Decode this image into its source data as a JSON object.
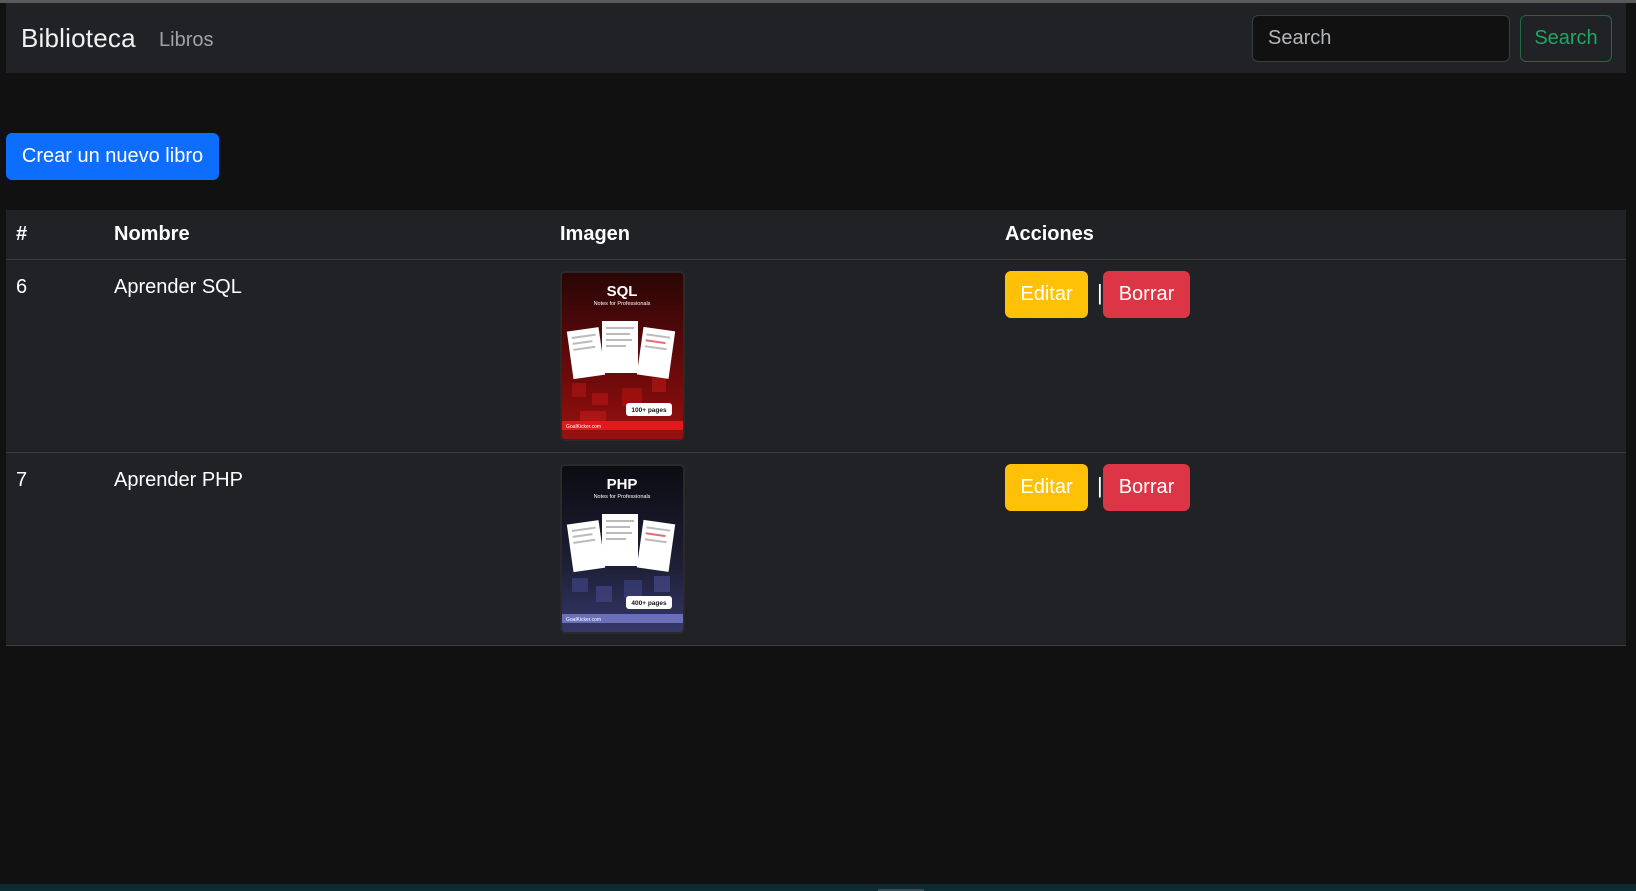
{
  "navbar": {
    "brand": "Biblioteca",
    "link": "Libros",
    "search_placeholder": "Search",
    "search_button": "Search"
  },
  "actions": {
    "create_label": "Crear un nuevo libro"
  },
  "table": {
    "headers": [
      "#",
      "Nombre",
      "Imagen",
      "Acciones"
    ],
    "rows": [
      {
        "id": "6",
        "name": "Aprender SQL",
        "cover_title": "SQL",
        "cover_subtitle": "Notes for Professionals",
        "cover_pages": "100+ pages",
        "cover_site": "GoalKicker.com",
        "edit": "Editar",
        "sep": "|",
        "delete": "Borrar"
      },
      {
        "id": "7",
        "name": "Aprender PHP",
        "cover_title": "PHP",
        "cover_subtitle": "Notes for Professionals",
        "cover_pages": "400+ pages",
        "cover_site": "GoalKicker.com",
        "edit": "Editar",
        "sep": "|",
        "delete": "Borrar"
      }
    ]
  },
  "colors": {
    "primary": "#0d6efd",
    "warning": "#ffc107",
    "danger": "#dc3545",
    "success": "#20a565",
    "sql_cover": "#8b0d0d",
    "php_cover": "#3c3f73"
  }
}
